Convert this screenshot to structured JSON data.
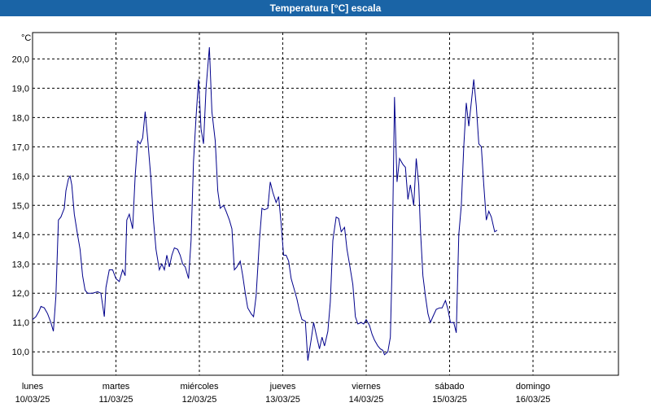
{
  "window": {
    "title": "Temperatura [°C] escala"
  },
  "chart_data": {
    "type": "line",
    "title": "Temperatura [°C] escala",
    "ylabel": "°C",
    "ylim": [
      9.2,
      20.9
    ],
    "yticks": [
      10,
      11,
      12,
      13,
      14,
      15,
      16,
      17,
      18,
      19,
      20
    ],
    "ytick_labels": [
      "10,0",
      "11,0",
      "12,0",
      "13,0",
      "14,0",
      "15,0",
      "16,0",
      "17,0",
      "18,0",
      "19,0",
      "20,0"
    ],
    "xlim": [
      0,
      7
    ],
    "xticks": [
      {
        "pos": 0,
        "day": "lunes",
        "date": "10/03/25"
      },
      {
        "pos": 1,
        "day": "martes",
        "date": "11/03/25"
      },
      {
        "pos": 2,
        "day": "miércoles",
        "date": "12/03/25"
      },
      {
        "pos": 3,
        "day": "jueves",
        "date": "13/03/25"
      },
      {
        "pos": 4,
        "day": "viernes",
        "date": "14/03/25"
      },
      {
        "pos": 5,
        "day": "sábado",
        "date": "15/03/25"
      },
      {
        "pos": 6,
        "day": "domingo",
        "date": "16/03/25"
      }
    ],
    "grid": true,
    "series": [
      {
        "color": "#00008b",
        "points": [
          [
            0.0,
            11.1
          ],
          [
            0.04,
            11.2
          ],
          [
            0.08,
            11.4
          ],
          [
            0.1,
            11.55
          ],
          [
            0.14,
            11.5
          ],
          [
            0.18,
            11.3
          ],
          [
            0.22,
            11.0
          ],
          [
            0.25,
            10.7
          ],
          [
            0.28,
            11.9
          ],
          [
            0.31,
            14.5
          ],
          [
            0.34,
            14.6
          ],
          [
            0.38,
            14.9
          ],
          [
            0.4,
            15.5
          ],
          [
            0.43,
            15.9
          ],
          [
            0.45,
            16.0
          ],
          [
            0.47,
            15.7
          ],
          [
            0.5,
            14.7
          ],
          [
            0.54,
            14.0
          ],
          [
            0.57,
            13.5
          ],
          [
            0.6,
            12.6
          ],
          [
            0.63,
            12.1
          ],
          [
            0.66,
            12.0
          ],
          [
            0.72,
            12.0
          ],
          [
            0.78,
            12.05
          ],
          [
            0.82,
            12.0
          ],
          [
            0.86,
            11.2
          ],
          [
            0.88,
            12.2
          ],
          [
            0.92,
            12.8
          ],
          [
            0.96,
            12.8
          ],
          [
            1.0,
            12.5
          ],
          [
            1.04,
            12.4
          ],
          [
            1.08,
            12.8
          ],
          [
            1.11,
            12.6
          ],
          [
            1.13,
            14.5
          ],
          [
            1.16,
            14.7
          ],
          [
            1.2,
            14.2
          ],
          [
            1.23,
            16.0
          ],
          [
            1.26,
            17.2
          ],
          [
            1.29,
            17.1
          ],
          [
            1.32,
            17.3
          ],
          [
            1.35,
            18.2
          ],
          [
            1.38,
            17.3
          ],
          [
            1.42,
            15.9
          ],
          [
            1.45,
            14.5
          ],
          [
            1.48,
            13.5
          ],
          [
            1.52,
            12.8
          ],
          [
            1.55,
            13.0
          ],
          [
            1.58,
            12.8
          ],
          [
            1.61,
            13.3
          ],
          [
            1.64,
            12.9
          ],
          [
            1.67,
            13.3
          ],
          [
            1.7,
            13.55
          ],
          [
            1.74,
            13.5
          ],
          [
            1.77,
            13.3
          ],
          [
            1.8,
            13.0
          ],
          [
            1.83,
            12.9
          ],
          [
            1.87,
            12.5
          ],
          [
            1.9,
            13.8
          ],
          [
            1.93,
            16.5
          ],
          [
            1.96,
            18.0
          ],
          [
            1.99,
            19.3
          ],
          [
            2.02,
            17.6
          ],
          [
            2.05,
            17.1
          ],
          [
            2.08,
            19.0
          ],
          [
            2.12,
            20.4
          ],
          [
            2.15,
            18.2
          ],
          [
            2.19,
            17.2
          ],
          [
            2.22,
            15.5
          ],
          [
            2.25,
            14.9
          ],
          [
            2.29,
            15.0
          ],
          [
            2.32,
            14.8
          ],
          [
            2.36,
            14.5
          ],
          [
            2.39,
            14.2
          ],
          [
            2.42,
            12.8
          ],
          [
            2.45,
            12.9
          ],
          [
            2.49,
            13.1
          ],
          [
            2.52,
            12.6
          ],
          [
            2.55,
            12.0
          ],
          [
            2.58,
            11.5
          ],
          [
            2.62,
            11.3
          ],
          [
            2.65,
            11.2
          ],
          [
            2.68,
            11.9
          ],
          [
            2.72,
            13.8
          ],
          [
            2.75,
            14.9
          ],
          [
            2.78,
            14.85
          ],
          [
            2.82,
            14.9
          ],
          [
            2.85,
            15.8
          ],
          [
            2.88,
            15.45
          ],
          [
            2.92,
            15.1
          ],
          [
            2.95,
            15.3
          ],
          [
            2.98,
            14.4
          ],
          [
            3.01,
            13.3
          ],
          [
            3.04,
            13.3
          ],
          [
            3.07,
            13.1
          ],
          [
            3.1,
            12.5
          ],
          [
            3.14,
            12.1
          ],
          [
            3.17,
            11.8
          ],
          [
            3.2,
            11.4
          ],
          [
            3.23,
            11.1
          ],
          [
            3.27,
            11.05
          ],
          [
            3.3,
            9.7
          ],
          [
            3.34,
            10.4
          ],
          [
            3.37,
            11.0
          ],
          [
            3.4,
            10.6
          ],
          [
            3.44,
            10.1
          ],
          [
            3.47,
            10.5
          ],
          [
            3.5,
            10.2
          ],
          [
            3.54,
            10.7
          ],
          [
            3.57,
            11.7
          ],
          [
            3.6,
            13.8
          ],
          [
            3.64,
            14.6
          ],
          [
            3.67,
            14.55
          ],
          [
            3.7,
            14.1
          ],
          [
            3.74,
            14.25
          ],
          [
            3.77,
            13.5
          ],
          [
            3.8,
            13.0
          ],
          [
            3.84,
            12.3
          ],
          [
            3.87,
            11.2
          ],
          [
            3.9,
            10.95
          ],
          [
            3.94,
            11.0
          ],
          [
            3.97,
            10.95
          ],
          [
            4.0,
            11.1
          ],
          [
            4.04,
            10.9
          ],
          [
            4.07,
            10.6
          ],
          [
            4.1,
            10.4
          ],
          [
            4.14,
            10.2
          ],
          [
            4.17,
            10.1
          ],
          [
            4.2,
            10.05
          ],
          [
            4.22,
            9.9
          ],
          [
            4.26,
            10.0
          ],
          [
            4.29,
            10.5
          ],
          [
            4.31,
            12.9
          ],
          [
            4.34,
            18.7
          ],
          [
            4.37,
            15.8
          ],
          [
            4.4,
            16.6
          ],
          [
            4.44,
            16.4
          ],
          [
            4.47,
            16.3
          ],
          [
            4.5,
            15.2
          ],
          [
            4.53,
            15.7
          ],
          [
            4.57,
            15.0
          ],
          [
            4.6,
            16.6
          ],
          [
            4.63,
            15.7
          ],
          [
            4.65,
            14.2
          ],
          [
            4.68,
            12.6
          ],
          [
            4.71,
            11.9
          ],
          [
            4.74,
            11.3
          ],
          [
            4.77,
            11.0
          ],
          [
            4.8,
            11.2
          ],
          [
            4.84,
            11.45
          ],
          [
            4.88,
            11.5
          ],
          [
            4.91,
            11.5
          ],
          [
            4.95,
            11.75
          ],
          [
            4.98,
            11.45
          ],
          [
            5.01,
            11.0
          ],
          [
            5.05,
            11.0
          ],
          [
            5.08,
            10.65
          ],
          [
            5.11,
            14.0
          ],
          [
            5.14,
            15.0
          ],
          [
            5.17,
            17.0
          ],
          [
            5.2,
            18.5
          ],
          [
            5.23,
            17.7
          ],
          [
            5.26,
            18.5
          ],
          [
            5.29,
            19.3
          ],
          [
            5.32,
            18.4
          ],
          [
            5.35,
            17.1
          ],
          [
            5.38,
            17.0
          ],
          [
            5.41,
            15.7
          ],
          [
            5.44,
            14.5
          ],
          [
            5.47,
            14.8
          ],
          [
            5.5,
            14.6
          ],
          [
            5.54,
            14.1
          ],
          [
            5.57,
            14.15
          ]
        ]
      }
    ]
  }
}
